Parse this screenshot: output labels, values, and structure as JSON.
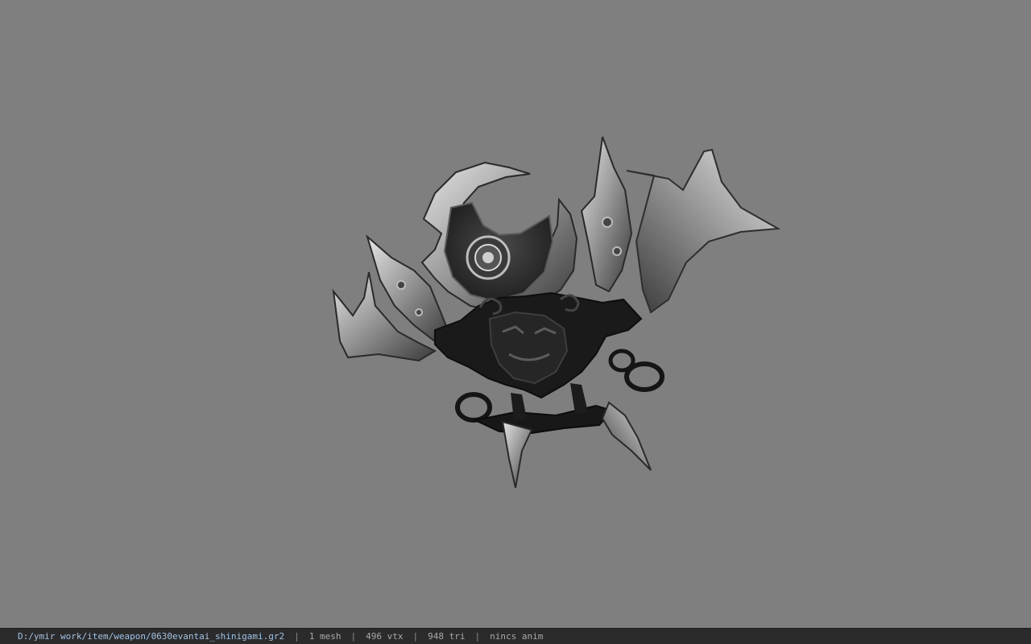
{
  "viewport": {
    "background_color": "#7f7f7f",
    "model": {
      "icon": "weapon-model",
      "metal_light": "#d8d8d8",
      "metal_mid": "#8c8c8c",
      "metal_dark": "#2c2c2c",
      "core_dark": "#141414"
    }
  },
  "statusbar": {
    "path": "D:/ymir work/item/weapon/0630evantai_shinigami.gr2",
    "separator": "|",
    "mesh": "1 mesh",
    "vertices": "496 vtx",
    "triangles": "948 tri",
    "anim": "nincs anim",
    "background_color": "#2b2b2b",
    "path_color": "#9fc3e6"
  }
}
